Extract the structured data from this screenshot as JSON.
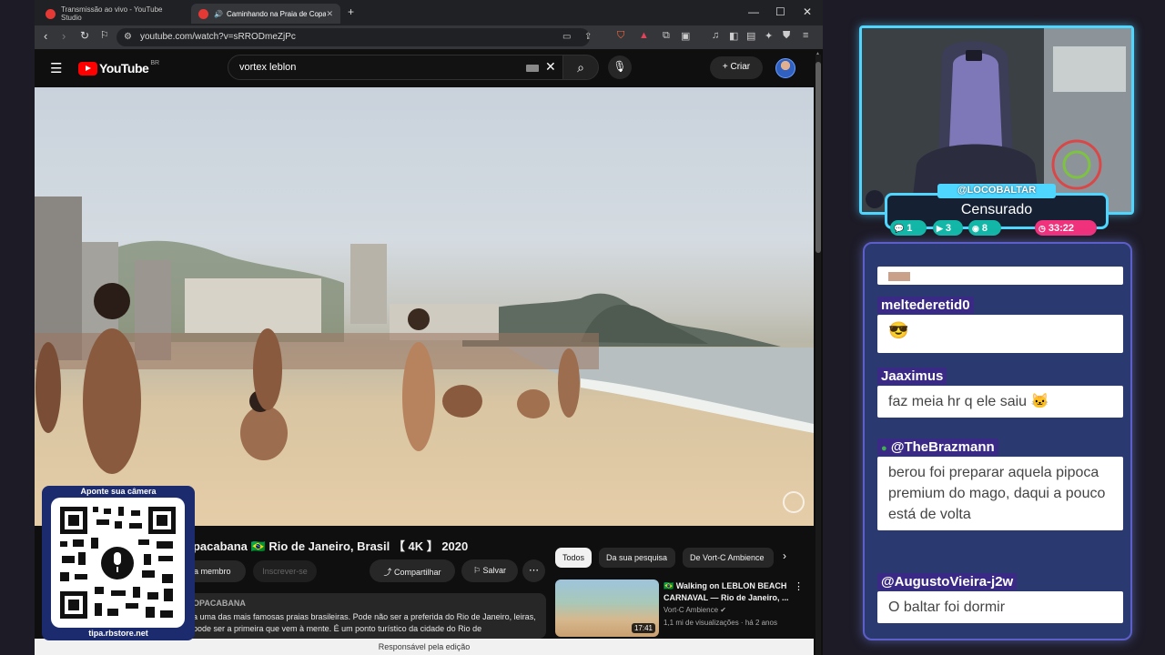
{
  "browser": {
    "tabs": [
      {
        "title": "Transmissão ao vivo - YouTube Studio"
      },
      {
        "title": "Caminhando na Praia de Copacabana"
      }
    ],
    "url": "youtube.com/watch?v=sRRODmeZjPc"
  },
  "youtube": {
    "logo_text": "YouTube",
    "country": "BR",
    "search_query": "vortex leblon",
    "create_label": "Criar"
  },
  "video": {
    "title": "opacabana 🇧🇷 Rio de Janeiro, Brasil 【 4K 】 2020",
    "join_label": "eja membro",
    "subscribe_label": "Inscrever-se",
    "share_label": "Compartilhar",
    "save_label": "Salvar",
    "desc_channel": "OPACABANA",
    "desc_text": "a uma das mais famosas praias brasileiras. Pode não ser a preferida do Rio de Janeiro, leiras, pode ser a primeira que vem à mente. É um ponto turístico da cidade do Rio de"
  },
  "recommendations": {
    "chips": [
      "Todos",
      "Da sua pesquisa",
      "De Vort-C Ambience"
    ],
    "items": [
      {
        "title": "🇧🇷 Walking on LEBLON BEACH CARNAVAL — Rio de Janeiro, ...",
        "channel": "Vort-C Ambience",
        "meta": "1,1 mi de visualizações · há 2 anos",
        "duration": "17:41"
      }
    ]
  },
  "status_bar": "Responsável pela edição",
  "qr": {
    "title": "Aponte sua câmera",
    "footer": "tipa.rbstore.net"
  },
  "stream": {
    "username": "@LOCOBALTAR",
    "status": "Censurado",
    "badges": {
      "chat": "1",
      "youtube": "3",
      "viewers": "8",
      "time": "33:22"
    }
  },
  "chat": {
    "messages": [
      {
        "user": "meltederetid0",
        "text": ""
      },
      {
        "user": "Jaaximus",
        "text": "faz meia hr q ele saiu"
      },
      {
        "user": "@TheBrazmann",
        "text": "berou foi preparar aquela pipoca premium do mago, daqui a pouco está de volta"
      },
      {
        "user": "@AugustoVieira-j2w",
        "text": "O baltar foi dormir"
      }
    ]
  }
}
